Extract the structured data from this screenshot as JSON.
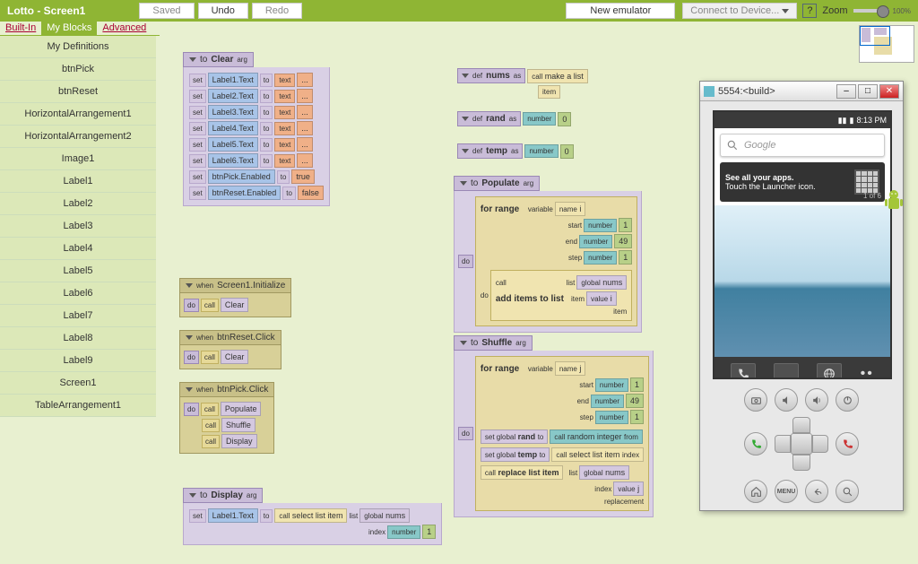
{
  "top": {
    "title": "Lotto - Screen1",
    "saved": "Saved",
    "undo": "Undo",
    "redo": "Redo",
    "new_emulator": "New emulator",
    "connect": "Connect to Device...",
    "zoom": "Zoom",
    "zoom_pct": "100%"
  },
  "tabs": {
    "builtin": "Built-In",
    "myblocks": "My Blocks",
    "advanced": "Advanced"
  },
  "sidebar": {
    "items": [
      "My Definitions",
      "btnPick",
      "btnReset",
      "HorizontalArrangement1",
      "HorizontalArrangement2",
      "Image1",
      "Label1",
      "Label2",
      "Label3",
      "Label4",
      "Label5",
      "Label6",
      "Label7",
      "Label8",
      "Label9",
      "Screen1",
      "TableArrangement1"
    ]
  },
  "kw": {
    "to": "to",
    "set": "set",
    "do": "do",
    "call": "call",
    "arg": "arg",
    "when": "when",
    "def": "def",
    "as": "as",
    "text": "text",
    "name": "name",
    "number": "number",
    "item": "item",
    "list": "list",
    "value": "value",
    "global": "global",
    "index": "index",
    "from": "from",
    "variable": "variable",
    "start": "start",
    "end": "end",
    "step": "step",
    "for_range": "for range",
    "set_global": "set global",
    "replacement": "replacement"
  },
  "blocks": {
    "clear": {
      "title": "Clear",
      "rows": [
        {
          "prop": "Label1.Text",
          "val": "...",
          "vtype": "text"
        },
        {
          "prop": "Label2.Text",
          "val": "...",
          "vtype": "text"
        },
        {
          "prop": "Label3.Text",
          "val": "...",
          "vtype": "text"
        },
        {
          "prop": "Label4.Text",
          "val": "...",
          "vtype": "text"
        },
        {
          "prop": "Label5.Text",
          "val": "...",
          "vtype": "text"
        },
        {
          "prop": "Label6.Text",
          "val": "...",
          "vtype": "text"
        },
        {
          "prop": "btnPick.Enabled",
          "val": "true",
          "vtype": "bool"
        },
        {
          "prop": "btnReset.Enabled",
          "val": "false",
          "vtype": "bool"
        }
      ]
    },
    "init": {
      "event": "Screen1.Initialize",
      "call": "Clear"
    },
    "reset": {
      "event": "btnReset.Click",
      "call": "Clear"
    },
    "pick": {
      "event": "btnPick.Click",
      "calls": [
        "Populate",
        "Shuffle",
        "Display"
      ]
    },
    "nums_def": {
      "var": "nums",
      "call": "make a list"
    },
    "rand_def": {
      "var": "rand",
      "val": "0"
    },
    "temp_def": {
      "var": "temp",
      "val": "0"
    },
    "populate": {
      "title": "Populate",
      "var": "i",
      "start": "1",
      "end": "49",
      "step": "1",
      "body_call": "add items to list",
      "list_g": "nums",
      "val_g": "i"
    },
    "shuffle": {
      "title": "Shuffle",
      "var": "j",
      "start": "1",
      "end": "49",
      "step": "1",
      "rand": "rand",
      "rand_call": "random integer",
      "temp": "temp",
      "temp_call": "select list item",
      "repl": "replace list item",
      "g_nums": "nums",
      "g_j": "j"
    },
    "display": {
      "title": "Display",
      "prop": "Label1.Text",
      "call": "select list item",
      "g": "nums",
      "idx": "1"
    }
  },
  "emu": {
    "title": "5554:<build>",
    "time": "8:13 PM",
    "search_placeholder": "Google",
    "tip1": "See all your apps.",
    "tip2": "Touch the Launcher icon.",
    "tip_badge": "1 of 6",
    "menu": "MENU"
  }
}
